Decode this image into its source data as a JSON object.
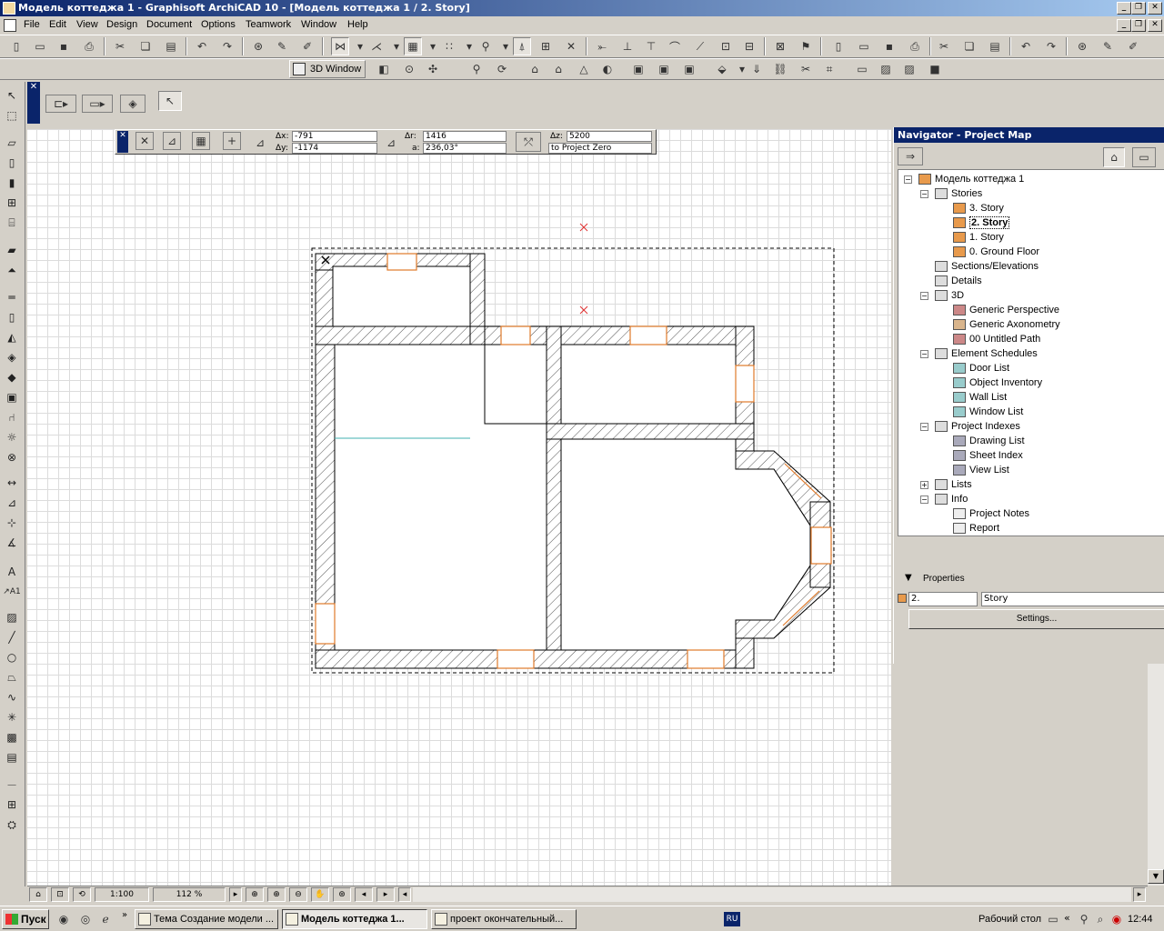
{
  "window": {
    "title": "Модель коттеджа 1 - Graphisoft ArchiCAD 10 - [Модель коттеджа 1 / 2. Story]"
  },
  "menu": [
    "File",
    "Edit",
    "View",
    "Design",
    "Document",
    "Options",
    "Teamwork",
    "Window",
    "Help"
  ],
  "toolbar2": {
    "three_d_window": "3D Window"
  },
  "coords": {
    "dx_label": "Δx:",
    "dx": "-791",
    "dy_label": "Δy:",
    "dy": "-1174",
    "dr_label": "Δr:",
    "dr": "1416",
    "a_label": "a:",
    "a": "236,03°",
    "dz_label": "Δz:",
    "dz": "5200",
    "reference": "to Project Zero"
  },
  "navigator": {
    "title": "Navigator - Project Map",
    "tree": [
      {
        "label": "Модель коттеджа 1",
        "icon": "house-icon"
      },
      {
        "label": "Stories",
        "icon": "stories-icon"
      },
      {
        "label": "3. Story",
        "icon": "story-icon"
      },
      {
        "label": "2. Story",
        "icon": "story-icon",
        "selected": true
      },
      {
        "label": "1. Story",
        "icon": "story-icon"
      },
      {
        "label": "0. Ground Floor",
        "icon": "story-icon"
      },
      {
        "label": "Sections/Elevations",
        "icon": "section-icon"
      },
      {
        "label": "Details",
        "icon": "details-icon"
      },
      {
        "label": "3D",
        "icon": "3d-icon"
      },
      {
        "label": "Generic Perspective",
        "icon": "camera-icon"
      },
      {
        "label": "Generic Axonometry",
        "icon": "axonometry-icon"
      },
      {
        "label": "00 Untitled Path",
        "icon": "path-icon"
      },
      {
        "label": "Element Schedules",
        "icon": "schedule-icon"
      },
      {
        "label": "Door List",
        "icon": "list-icon"
      },
      {
        "label": "Object Inventory",
        "icon": "list-icon"
      },
      {
        "label": "Wall List",
        "icon": "list-icon"
      },
      {
        "label": "Window List",
        "icon": "list-icon"
      },
      {
        "label": "Project Indexes",
        "icon": "index-icon"
      },
      {
        "label": "Drawing List",
        "icon": "list-icon"
      },
      {
        "label": "Sheet Index",
        "icon": "list-icon"
      },
      {
        "label": "View List",
        "icon": "list-icon"
      },
      {
        "label": "Lists",
        "icon": "folder-icon"
      },
      {
        "label": "Info",
        "icon": "info-icon"
      },
      {
        "label": "Project Notes",
        "icon": "notes-icon"
      },
      {
        "label": "Report",
        "icon": "report-icon"
      }
    ],
    "properties_label": "Properties",
    "prop_id": "2.",
    "prop_name": "Story",
    "settings_button": "Settings..."
  },
  "status": {
    "scale": "1:100",
    "zoom": "112 %"
  },
  "taskbar": {
    "start": "Пуск",
    "tasks": [
      {
        "label": "Тема Создание модели ..."
      },
      {
        "label": "Модель коттеджа 1...",
        "active": true
      },
      {
        "label": "проект окончательный..."
      }
    ],
    "lang": "RU",
    "desktop": "Рабочий стол",
    "clock": "12:44"
  },
  "colors": {
    "titlebar": "#0a246a",
    "window_opening": "#e07a2a",
    "marker": "#e03030"
  }
}
